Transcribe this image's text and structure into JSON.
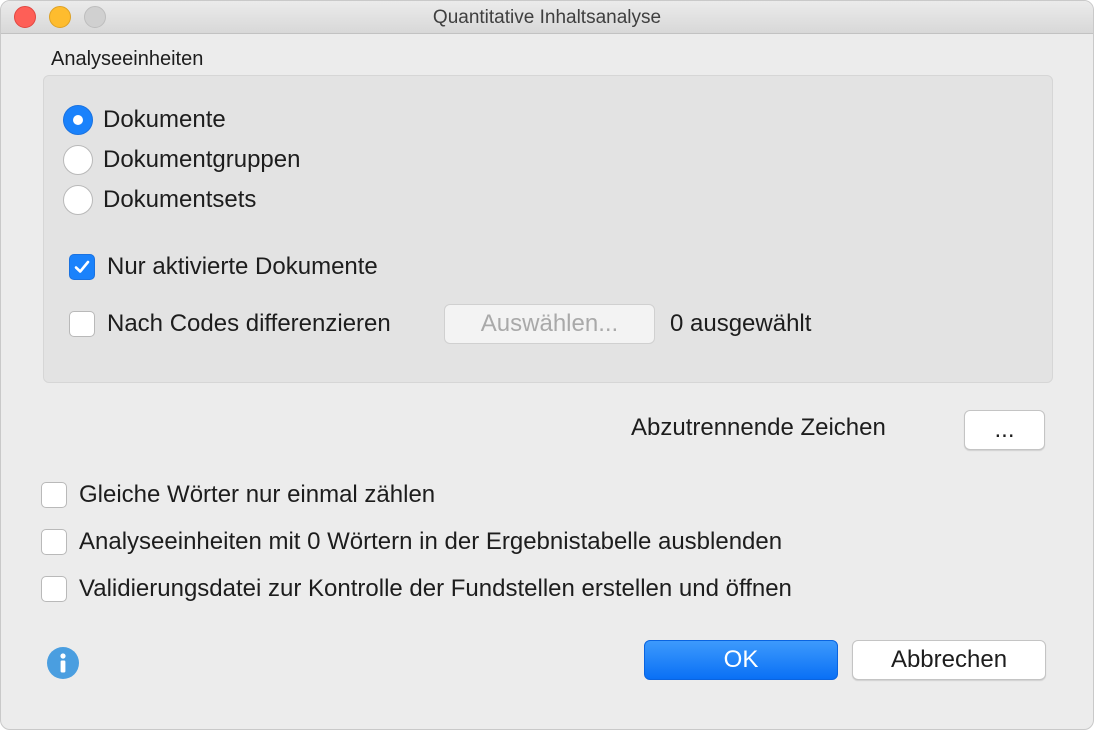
{
  "window": {
    "title": "Quantitative Inhaltsanalyse"
  },
  "analysis_units": {
    "label": "Analyseeinheiten",
    "options": [
      {
        "label": "Dokumente",
        "selected": true
      },
      {
        "label": "Dokumentgruppen",
        "selected": false
      },
      {
        "label": "Dokumentsets",
        "selected": false
      }
    ],
    "only_activated": {
      "label": "Nur aktivierte Dokumente",
      "checked": true
    },
    "differentiate_codes": {
      "label": "Nach Codes differenzieren",
      "checked": false
    },
    "select_button": "Auswählen...",
    "selected_count": "0 ausgewählt"
  },
  "separator": {
    "label": "Abzutrennende Zeichen",
    "button": "..."
  },
  "options": [
    {
      "label": "Gleiche Wörter nur einmal zählen",
      "checked": false
    },
    {
      "label": "Analyseeinheiten mit 0 Wörtern in der Ergebnistabelle ausblenden",
      "checked": false
    },
    {
      "label": "Validierungsdatei zur Kontrolle der Fundstellen erstellen und öffnen",
      "checked": false
    }
  ],
  "footer": {
    "ok": "OK",
    "cancel": "Abbrechen",
    "info_icon": "info-icon"
  },
  "colors": {
    "accent": "#1a82fb",
    "close": "#fe5f57",
    "minimize": "#febc2e",
    "zoom_disabled": "#d0d0d0",
    "info": "#4a9ee0"
  }
}
